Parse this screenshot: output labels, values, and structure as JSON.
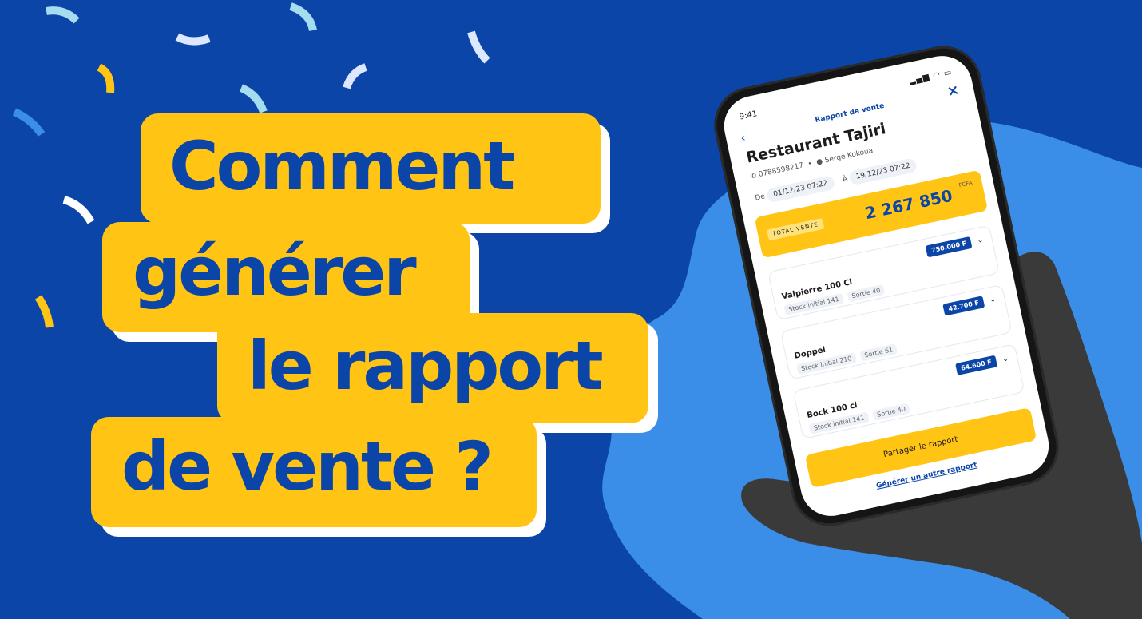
{
  "colors": {
    "background": "#0b45a8",
    "accent_yellow": "#ffc414",
    "blob_blue": "#3b8ee8",
    "shadow_white": "#ffffff"
  },
  "headline": {
    "line1": "Comment",
    "line2": "générer",
    "line3": "le rapport",
    "line4": "de vente ?"
  },
  "phone": {
    "status_time": "9:41",
    "status_icons": "▂▄▆ ◠ ▭",
    "header_title": "Rapport de vente",
    "back_icon": "back-chevron-icon",
    "close_icon": "close-icon",
    "store_name": "Restaurant Tajiri",
    "phone_number": "0788598217",
    "user_name": "Serge Kokoua",
    "from_label": "De",
    "from_date": "01/12/23 07:22",
    "to_label": "À",
    "to_date": "19/12/23 07:22",
    "total_label": "TOTAL VENTE",
    "total_value": "2 267 850",
    "total_currency": "FCFA",
    "products": [
      {
        "name": "Valpierre 100 Cl",
        "price": "750.000 F",
        "stock": "Stock initial 141",
        "sortie": "Sortie 40"
      },
      {
        "name": "Doppel",
        "price": "42.700 F",
        "stock": "Stock initial 210",
        "sortie": "Sortie 61"
      },
      {
        "name": "Bock 100 cl",
        "price": "64.600 F",
        "stock": "Stock initial 141",
        "sortie": "Sortie 40"
      }
    ],
    "share_label": "Partager le rapport",
    "other_label": "Générer un autre rapport"
  }
}
